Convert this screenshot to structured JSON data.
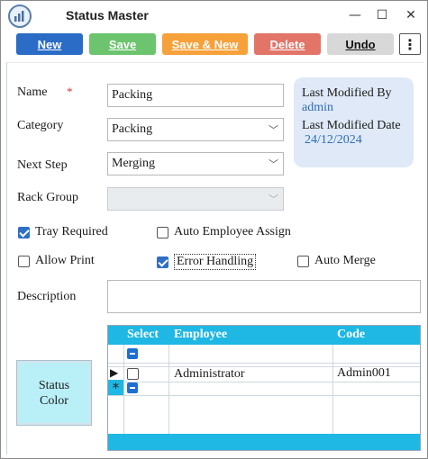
{
  "window": {
    "title": "Status Master",
    "controls": {
      "minimize": "—",
      "maximize": "☐",
      "close": "✕"
    }
  },
  "toolbar": {
    "new_label": "New",
    "save_label": "Save",
    "save_new_label": "Save & New",
    "delete_label": "Delete",
    "undo_label": "Undo",
    "more_label": "⋮",
    "colors": {
      "new": "#2a6cc6",
      "save": "#6cc46e",
      "save_new": "#f6a13a",
      "delete": "#e27468",
      "undo": "#d8d8d8"
    }
  },
  "form": {
    "name_label": "Name",
    "name_required_mark": "*",
    "name_value": "Packing",
    "category_label": "Category",
    "category_value": "Packing",
    "next_step_label": "Next Step",
    "next_step_value": "Merging",
    "rack_group_label": "Rack Group",
    "rack_group_value": "",
    "description_label": "Description",
    "description_value": ""
  },
  "info": {
    "last_modified_by_label": "Last Modified By",
    "last_modified_by_value": "admin",
    "last_modified_date_label": "Last Modified Date",
    "last_modified_date_value": "24/12/2024"
  },
  "options": {
    "tray_required": {
      "label": "Tray Required",
      "checked": true
    },
    "auto_employee_assign": {
      "label": "Auto Employee Assign",
      "checked": false
    },
    "allow_print": {
      "label": "Allow Print",
      "checked": false
    },
    "error_handling": {
      "label": "Error Handling",
      "checked": true
    },
    "auto_merge": {
      "label": "Auto Merge",
      "checked": false
    }
  },
  "status_color": {
    "label_line1": "Status",
    "label_line2": "Color",
    "color": "#b9f0f8"
  },
  "employee_grid": {
    "headers": [
      "Select",
      "Employee",
      "Code"
    ],
    "rows": [
      {
        "selected": false,
        "employee": "Administrator",
        "code": "Admin001"
      }
    ],
    "current_row_marker": "▶",
    "new_row_marker": "*",
    "header_color": "#1fb7e3"
  }
}
